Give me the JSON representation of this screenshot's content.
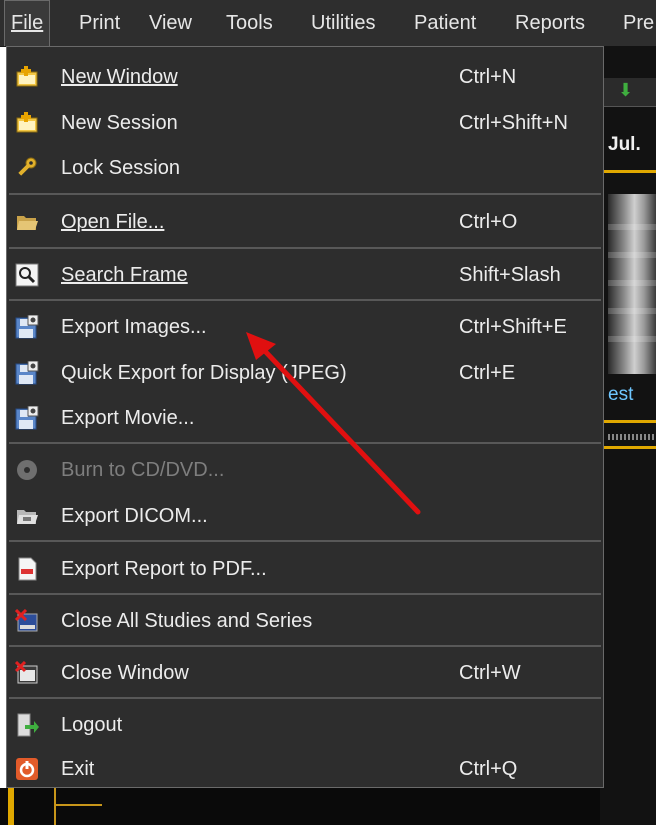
{
  "menubar": {
    "items": [
      {
        "label": "File",
        "mnemonic_index": 0
      },
      {
        "label": "Print"
      },
      {
        "label": "View"
      },
      {
        "label": "Tools"
      },
      {
        "label": "Utilities"
      },
      {
        "label": "Patient"
      },
      {
        "label": "Reports"
      },
      {
        "label": "Pre"
      }
    ]
  },
  "file_menu": {
    "new_window": {
      "label": "New Window",
      "shortcut": "Ctrl+N",
      "icon": "new-window-icon"
    },
    "new_session": {
      "label": "New Session",
      "shortcut": "Ctrl+Shift+N",
      "icon": "new-session-icon"
    },
    "lock_session": {
      "label": "Lock Session",
      "shortcut": "",
      "icon": "key-icon"
    },
    "open_file": {
      "label": "Open File...",
      "shortcut": "Ctrl+O",
      "icon": "folder-open-icon"
    },
    "search_frame": {
      "label": "Search Frame",
      "shortcut": "Shift+Slash",
      "icon": "search-icon"
    },
    "export_images": {
      "label": "Export Images...",
      "shortcut": "Ctrl+Shift+E",
      "icon": "export-icon"
    },
    "quick_export": {
      "label": "Quick Export for Display (JPEG)",
      "shortcut": "Ctrl+E",
      "icon": "export-icon"
    },
    "export_movie": {
      "label": "Export Movie...",
      "shortcut": "",
      "icon": "export-icon"
    },
    "burn_cd": {
      "label": "Burn to CD/DVD...",
      "shortcut": "",
      "icon": "disc-icon",
      "disabled": true
    },
    "export_dicom": {
      "label": "Export DICOM...",
      "shortcut": "",
      "icon": "folder-export-icon"
    },
    "export_pdf": {
      "label": "Export Report to PDF...",
      "shortcut": "",
      "icon": "pdf-icon"
    },
    "close_all": {
      "label": "Close All Studies and Series",
      "shortcut": "",
      "icon": "close-all-icon"
    },
    "close_window": {
      "label": "Close Window",
      "shortcut": "Ctrl+W",
      "icon": "close-window-icon"
    },
    "logout": {
      "label": "Logout",
      "shortcut": "",
      "icon": "logout-icon"
    },
    "exit": {
      "label": "Exit",
      "shortcut": "Ctrl+Q",
      "icon": "power-icon"
    }
  },
  "background": {
    "date_fragment": "Jul.",
    "series_label_fragment": "est"
  },
  "colors": {
    "menu_bg": "#2d2d2d",
    "menubar_bg": "#2e2e2e",
    "text": "#ececec",
    "disabled_text": "#7e7e7e",
    "separator": "#585858",
    "accent_yellow": "#e0a800",
    "annotation_arrow": "#e01010"
  }
}
